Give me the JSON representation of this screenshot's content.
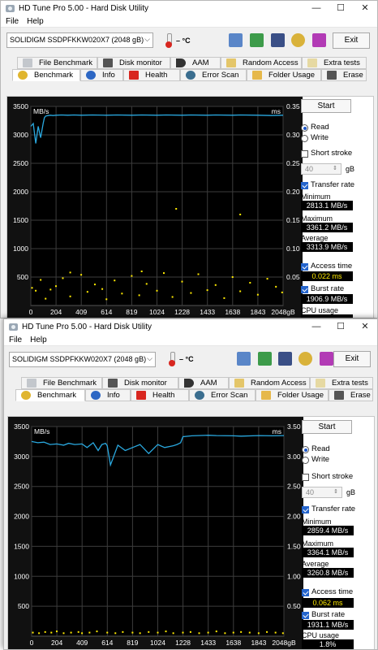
{
  "windows": [
    {
      "title": "HD Tune Pro 5.00 - Hard Disk Utility",
      "controls": {
        "minimize": "—",
        "maximize": "☐",
        "close": "✕"
      },
      "menu": [
        "File",
        "Help"
      ],
      "drive": "SOLIDIGM SSDPFKKW020X7 (2048 gB)",
      "temperature": "– °C",
      "exit_label": "Exit",
      "tabs_top": [
        "File Benchmark",
        "Disk monitor",
        "AAM",
        "Random Access",
        "Extra tests"
      ],
      "tabs_bottom": [
        "Benchmark",
        "Info",
        "Health",
        "Error Scan",
        "Folder Usage",
        "Erase"
      ],
      "active_tab": "Benchmark",
      "panel": {
        "start_label": "Start",
        "read_label": "Read",
        "write_label": "Write",
        "mode": "Read",
        "short_stroke_label": "Short stroke",
        "short_stroke_checked": false,
        "short_stroke_value": "40",
        "short_stroke_unit": "gB",
        "transfer_rate_label": "Transfer rate",
        "transfer_rate_checked": true,
        "minimum_label": "Minimum",
        "minimum": "2813.1 MB/s",
        "maximum_label": "Maximum",
        "maximum": "3361.2 MB/s",
        "average_label": "Average",
        "average": "3313.9 MB/s",
        "access_time_label": "Access time",
        "access_time_checked": true,
        "access_time": "0.022 ms",
        "burst_rate_label": "Burst rate",
        "burst_rate_checked": true,
        "burst_rate": "1906.9 MB/s",
        "cpu_usage_label": "CPU usage",
        "cpu_usage": ""
      }
    },
    {
      "title": "HD Tune Pro 5.00 - Hard Disk Utility",
      "controls": {
        "minimize": "—",
        "maximize": "☐",
        "close": "✕"
      },
      "menu": [
        "File",
        "Help"
      ],
      "drive": "SOLIDIGM SSDPFKKW020X7 (2048 gB)",
      "temperature": "– °C",
      "exit_label": "Exit",
      "tabs_top": [
        "File Benchmark",
        "Disk monitor",
        "AAM",
        "Random Access",
        "Extra tests"
      ],
      "tabs_bottom": [
        "Benchmark",
        "Info",
        "Health",
        "Error Scan",
        "Folder Usage",
        "Erase"
      ],
      "active_tab": "Benchmark",
      "panel": {
        "start_label": "Start",
        "read_label": "Read",
        "write_label": "Write",
        "mode": "Read",
        "short_stroke_label": "Short stroke",
        "short_stroke_checked": false,
        "short_stroke_value": "40",
        "short_stroke_unit": "gB",
        "transfer_rate_label": "Transfer rate",
        "transfer_rate_checked": true,
        "minimum_label": "Minimum",
        "minimum": "2859.4 MB/s",
        "maximum_label": "Maximum",
        "maximum": "3364.1 MB/s",
        "average_label": "Average",
        "average": "3260.8 MB/s",
        "access_time_label": "Access time",
        "access_time_checked": true,
        "access_time": "0.062 ms",
        "burst_rate_label": "Burst rate",
        "burst_rate_checked": true,
        "burst_rate": "1931.1 MB/s",
        "cpu_usage_label": "CPU usage",
        "cpu_usage": "1.8%"
      }
    }
  ],
  "colors": {
    "chart_bg": "#000000",
    "grid": "#3c3c3c",
    "transfer_line": "#2aa9e0",
    "access_points": "#ffea00",
    "axis_text": "#ffffff"
  },
  "icons": [
    "drive-select-chevron-icon",
    "thermometer-icon",
    "copy-info-icon",
    "copy-screenshot-icon",
    "save-icon",
    "options-icon",
    "download-icon",
    "app-icon"
  ],
  "chart_data": [
    {
      "type": "line",
      "title": "",
      "ylabel_left": "MB/s",
      "ylabel_right": "ms",
      "xlabel": "gB",
      "x_ticks": [
        "0",
        "204",
        "409",
        "614",
        "819",
        "1024",
        "1228",
        "1433",
        "1638",
        "1843",
        "2048gB"
      ],
      "xlim": [
        0,
        2048
      ],
      "y_ticks_left": [
        "500",
        "1000",
        "1500",
        "2000",
        "2500",
        "3000",
        "3500"
      ],
      "y_ticks_right": [
        "0.05",
        "0.10",
        "0.15",
        "0.20",
        "0.25",
        "0.30",
        "0.35"
      ],
      "ylim_left": [
        0,
        3500
      ],
      "ylim_right": [
        0,
        0.35
      ],
      "grid": true,
      "series": [
        {
          "name": "Transfer rate",
          "axis": "left",
          "x": [
            0,
            20,
            40,
            60,
            80,
            100,
            110,
            120,
            140,
            160,
            180,
            204,
            250,
            300,
            350,
            409,
            500,
            614,
            700,
            819,
            900,
            1024,
            1100,
            1228,
            1300,
            1433,
            1500,
            1638,
            1700,
            1843,
            1950,
            2048
          ],
          "y": [
            3150,
            3200,
            2850,
            3150,
            2950,
            3200,
            3300,
            3330,
            3340,
            3345,
            3340,
            3345,
            3350,
            3345,
            3350,
            3345,
            3350,
            3345,
            3350,
            3345,
            3350,
            3345,
            3350,
            3345,
            3350,
            3345,
            3350,
            3345,
            3350,
            3345,
            3340,
            3345
          ]
        },
        {
          "name": "Access time",
          "axis": "right",
          "style": "scatter",
          "x": [
            10,
            40,
            80,
            120,
            160,
            204,
            260,
            320,
            409,
            460,
            520,
            580,
            614,
            680,
            740,
            819,
            880,
            940,
            1024,
            1080,
            1150,
            1228,
            1300,
            1360,
            1433,
            1500,
            1570,
            1638,
            1700,
            1780,
            1843,
            1920,
            1990,
            2040,
            1180,
            1700,
            320,
            900
          ],
          "y": [
            0.031,
            0.026,
            0.045,
            0.012,
            0.028,
            0.034,
            0.048,
            0.016,
            0.054,
            0.024,
            0.037,
            0.029,
            0.011,
            0.044,
            0.021,
            0.052,
            0.018,
            0.038,
            0.026,
            0.057,
            0.015,
            0.042,
            0.022,
            0.055,
            0.027,
            0.036,
            0.013,
            0.05,
            0.025,
            0.04,
            0.019,
            0.047,
            0.033,
            0.023,
            0.17,
            0.16,
            0.058,
            0.06
          ]
        }
      ]
    },
    {
      "type": "line",
      "title": "",
      "ylabel_left": "MB/s",
      "ylabel_right": "ms",
      "xlabel": "gB",
      "x_ticks": [
        "0",
        "204",
        "409",
        "614",
        "819",
        "1024",
        "1228",
        "1433",
        "1638",
        "1843",
        "2048gB"
      ],
      "xlim": [
        0,
        2048
      ],
      "y_ticks_left": [
        "500",
        "1000",
        "1500",
        "2000",
        "2500",
        "3000",
        "3500"
      ],
      "y_ticks_right": [
        "0.50",
        "1.00",
        "1.50",
        "2.00",
        "2.50",
        "3.00",
        "3.50"
      ],
      "ylim_left": [
        0,
        3500
      ],
      "ylim_right": [
        0,
        3.5
      ],
      "grid": true,
      "series": [
        {
          "name": "Transfer rate",
          "axis": "left",
          "x": [
            0,
            50,
            100,
            150,
            204,
            260,
            300,
            350,
            409,
            450,
            500,
            540,
            570,
            600,
            614,
            640,
            700,
            760,
            819,
            880,
            950,
            1024,
            1080,
            1150,
            1180,
            1210,
            1228,
            1300,
            1433,
            1500,
            1638,
            1700,
            1843,
            1950,
            2048
          ],
          "y": [
            3250,
            3230,
            3240,
            3200,
            3210,
            3190,
            3220,
            3200,
            3210,
            3150,
            3230,
            3100,
            3200,
            3220,
            3180,
            2859,
            3190,
            3100,
            3150,
            3200,
            3050,
            3200,
            3150,
            3180,
            3200,
            3230,
            3330,
            3345,
            3355,
            3350,
            3345,
            3340,
            3350,
            3345,
            3350
          ]
        },
        {
          "name": "Access time",
          "axis": "right",
          "style": "scatter",
          "x": [
            10,
            60,
            110,
            160,
            204,
            260,
            320,
            380,
            409,
            470,
            530,
            614,
            680,
            740,
            819,
            880,
            950,
            1024,
            1090,
            1150,
            1228,
            1290,
            1360,
            1433,
            1500,
            1570,
            1638,
            1700,
            1770,
            1843,
            1910,
            1980,
            2040
          ],
          "y": [
            0.06,
            0.05,
            0.07,
            0.06,
            0.08,
            0.05,
            0.06,
            0.07,
            0.05,
            0.06,
            0.08,
            0.06,
            0.05,
            0.07,
            0.06,
            0.05,
            0.07,
            0.06,
            0.08,
            0.05,
            0.06,
            0.07,
            0.05,
            0.06,
            0.08,
            0.05,
            0.06,
            0.07,
            0.06,
            0.05,
            0.07,
            0.06,
            0.05
          ]
        }
      ]
    }
  ]
}
